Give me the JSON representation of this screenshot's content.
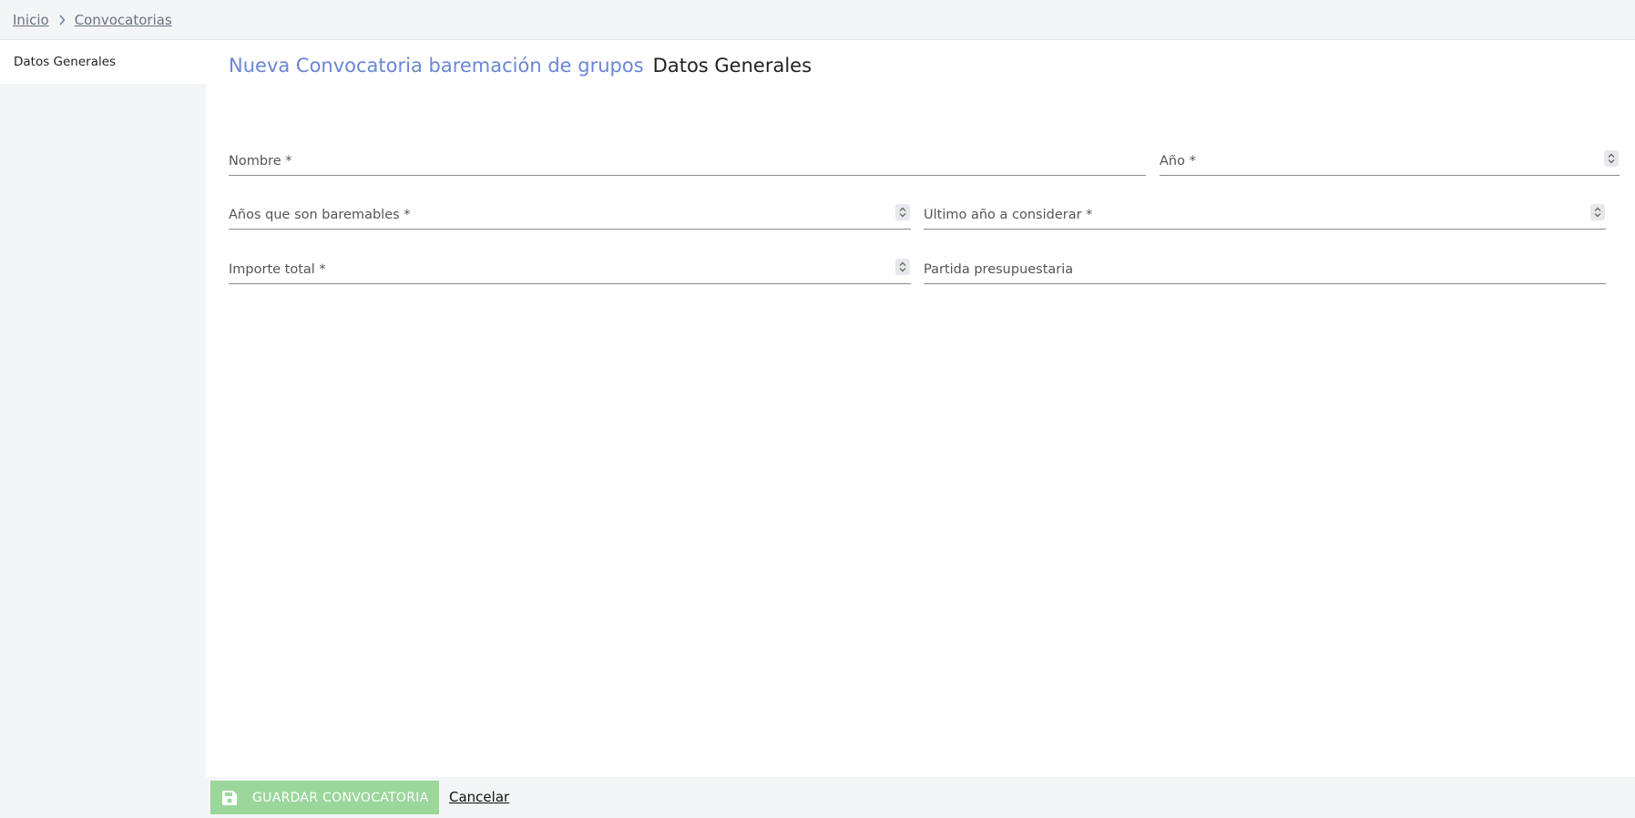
{
  "breadcrumb": {
    "items": [
      {
        "label": "Inicio"
      },
      {
        "label": "Convocatorias"
      }
    ]
  },
  "sidebar": {
    "items": [
      {
        "label": "Datos Generales"
      }
    ]
  },
  "header": {
    "title": "Nueva Convocatoria baremación de grupos",
    "subtitle": "Datos Generales"
  },
  "form": {
    "nombre": {
      "placeholder": "Nombre *",
      "value": ""
    },
    "ano": {
      "placeholder": "Año *",
      "value": ""
    },
    "anos_baremables": {
      "placeholder": "Años que son baremables *",
      "value": ""
    },
    "ultimo_ano": {
      "placeholder": "Último año a considerar *",
      "value": ""
    },
    "importe_total": {
      "placeholder": "Importe total *",
      "value": ""
    },
    "partida": {
      "placeholder": "Partida presupuestaria",
      "value": ""
    }
  },
  "footer": {
    "save_label": "GUARDAR CONVOCATORIA",
    "save_icon": "save-icon",
    "cancel_label": "Cancelar"
  },
  "colors": {
    "title_accent": "#6a86d6",
    "save_button": "#9bd69b",
    "background": "#f3f5f7"
  }
}
